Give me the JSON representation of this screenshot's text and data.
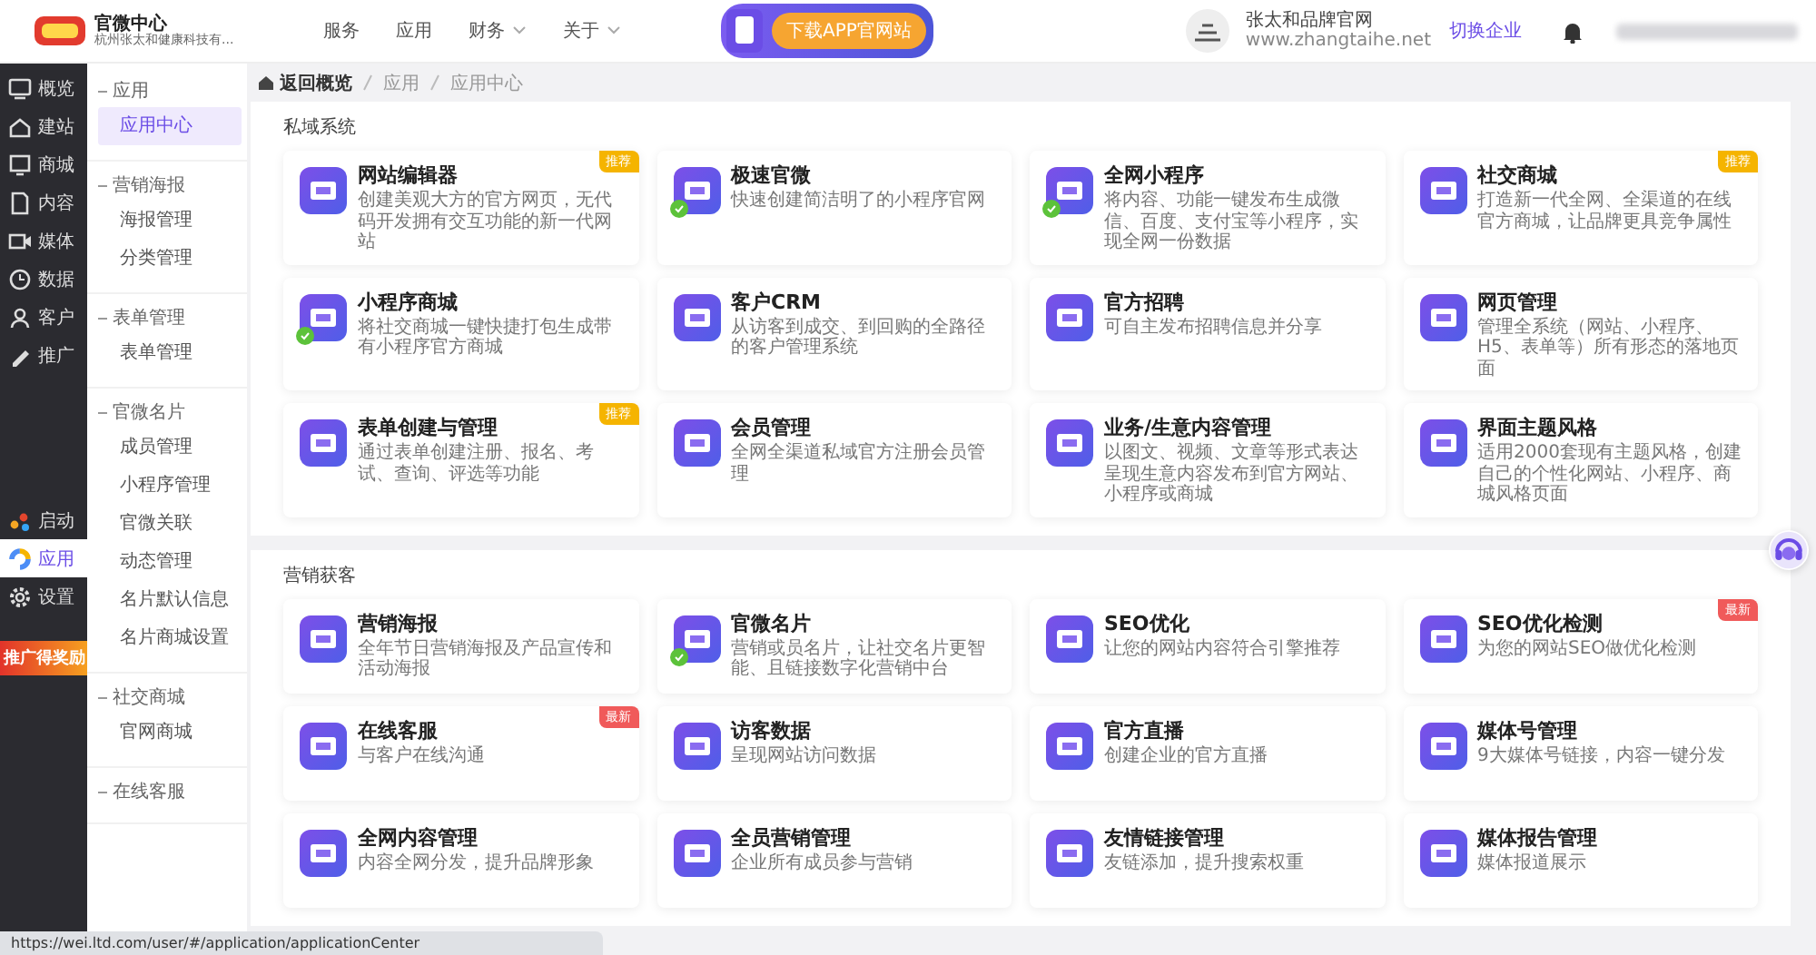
{
  "header": {
    "org_name": "官微中心",
    "org_subtitle": "杭州张太和健康科技有...",
    "nav": [
      {
        "label": "服务",
        "dropdown": false
      },
      {
        "label": "应用",
        "dropdown": false
      },
      {
        "label": "财务",
        "dropdown": true
      },
      {
        "label": "关于",
        "dropdown": true
      }
    ],
    "download_banner": "下载APP官网站",
    "brand": {
      "name": "张太和品牌官网",
      "url": "www.zhangtaihe.net"
    },
    "switch_label": "切换企业"
  },
  "sidebar": {
    "items": [
      {
        "label": "概览",
        "selected": false
      },
      {
        "label": "建站",
        "selected": false
      },
      {
        "label": "商城",
        "selected": false
      },
      {
        "label": "内容",
        "selected": false
      },
      {
        "label": "媒体",
        "selected": false
      },
      {
        "label": "数据",
        "selected": false
      },
      {
        "label": "客户",
        "selected": false
      },
      {
        "label": "推广",
        "selected": false
      }
    ],
    "lower_items": [
      {
        "label": "启动",
        "selected": false
      },
      {
        "label": "应用",
        "selected": true
      },
      {
        "label": "设置",
        "selected": false
      }
    ],
    "promo": "推广得奖励"
  },
  "subnav": {
    "groups": [
      {
        "title": "应用",
        "items": [
          {
            "label": "应用中心",
            "selected": true
          }
        ]
      },
      {
        "title": "营销海报",
        "items": [
          {
            "label": "海报管理",
            "selected": false
          },
          {
            "label": "分类管理",
            "selected": false
          }
        ]
      },
      {
        "title": "表单管理",
        "items": [
          {
            "label": "表单管理",
            "selected": false
          }
        ]
      },
      {
        "title": "官微名片",
        "items": [
          {
            "label": "成员管理",
            "selected": false
          },
          {
            "label": "小程序管理",
            "selected": false
          },
          {
            "label": "官微关联",
            "selected": false
          },
          {
            "label": "动态管理",
            "selected": false
          },
          {
            "label": "名片默认信息",
            "selected": false
          },
          {
            "label": "名片商城设置",
            "selected": false
          }
        ]
      },
      {
        "title": "社交商城",
        "items": [
          {
            "label": "官网商城",
            "selected": false
          }
        ]
      },
      {
        "title": "在线客服"
      }
    ]
  },
  "breadcrumb": [
    "返回概览",
    "应用",
    "应用中心"
  ],
  "sections": [
    {
      "title": "私域系统",
      "cards": [
        {
          "title": "网站编辑器",
          "description": "创建美观大方的官方网页，无代码开发拥有交互功能的新一代网站",
          "tag": {
            "text": "推荐",
            "color": "#f5b400"
          },
          "mini_program": false
        },
        {
          "title": "极速官微",
          "description": "快速创建简洁明了的小程序官网",
          "mini_program": true
        },
        {
          "title": "全网小程序",
          "description": "将内容、功能一键发布生成微信、百度、支付宝等小程序，实现全网一份数据",
          "mini_program": true
        },
        {
          "title": "社交商城",
          "description": "打造新一代全网、全渠道的在线官方商城，让品牌更具竞争属性",
          "tag": {
            "text": "推荐",
            "color": "#f5b400"
          },
          "mini_program": false
        },
        {
          "title": "小程序商城",
          "description": "将社交商城一键快捷打包生成带有小程序官方商城",
          "mini_program": true
        },
        {
          "title": "客户CRM",
          "description": "从访客到成交、到回购的全路径的客户管理系统",
          "mini_program": false
        },
        {
          "title": "官方招聘",
          "description": "可自主发布招聘信息并分享",
          "mini_program": false
        },
        {
          "title": "网页管理",
          "description": "管理全系统（网站、小程序、H5、表单等）所有形态的落地页面",
          "mini_program": false
        },
        {
          "title": "表单创建与管理",
          "description": "通过表单创建注册、报名、考试、查询、评选等功能",
          "tag": {
            "text": "推荐",
            "color": "#f5b400"
          },
          "mini_program": false
        },
        {
          "title": "会员管理",
          "description": "全网全渠道私域官方注册会员管理",
          "mini_program": false
        },
        {
          "title": "业务/生意内容管理",
          "description": "以图文、视频、文章等形式表达呈现生意内容发布到官方网站、小程序或商城",
          "mini_program": false
        },
        {
          "title": "界面主题风格",
          "description": "适用2000套现有主题风格，创建自己的个性化网站、小程序、商城风格页面",
          "mini_program": false
        }
      ]
    },
    {
      "title": "营销获客",
      "cards": [
        {
          "title": "营销海报",
          "description": "全年节日营销海报及产品宣传和活动海报",
          "mini_program": false
        },
        {
          "title": "官微名片",
          "description": "营销或员名片，让社交名片更智能、且链接数字化营销中台",
          "mini_program": true
        },
        {
          "title": "SEO优化",
          "description": "让您的网站内容符合引擎推荐",
          "mini_program": false
        },
        {
          "title": "SEO优化检测",
          "description": "为您的网站SEO做优化检测",
          "tag": {
            "text": "最新",
            "color": "#f05a5a"
          },
          "mini_program": false
        },
        {
          "title": "在线客服",
          "description": "与客户在线沟通",
          "tag": {
            "text": "最新",
            "color": "#f05a5a"
          },
          "mini_program": false
        },
        {
          "title": "访客数据",
          "description": "呈现网站访问数据",
          "mini_program": false
        },
        {
          "title": "官方直播",
          "description": "创建企业的官方直播",
          "mini_program": false
        },
        {
          "title": "媒体号管理",
          "description": "9大媒体号链接，内容一键分发",
          "mini_program": false
        },
        {
          "title": "全网内容管理",
          "description": "内容全网分发，提升品牌形象",
          "mini_program": false
        },
        {
          "title": "全员营销管理",
          "description": "企业所有成员参与营销",
          "mini_program": false
        },
        {
          "title": "友情链接管理",
          "description": "友链添加，提升搜索权重",
          "mini_program": false
        },
        {
          "title": "媒体报告管理",
          "description": "媒体报道展示",
          "mini_program": false
        }
      ]
    }
  ],
  "status_url": "https://wei.ltd.com/user/#/application/applicationCenter"
}
